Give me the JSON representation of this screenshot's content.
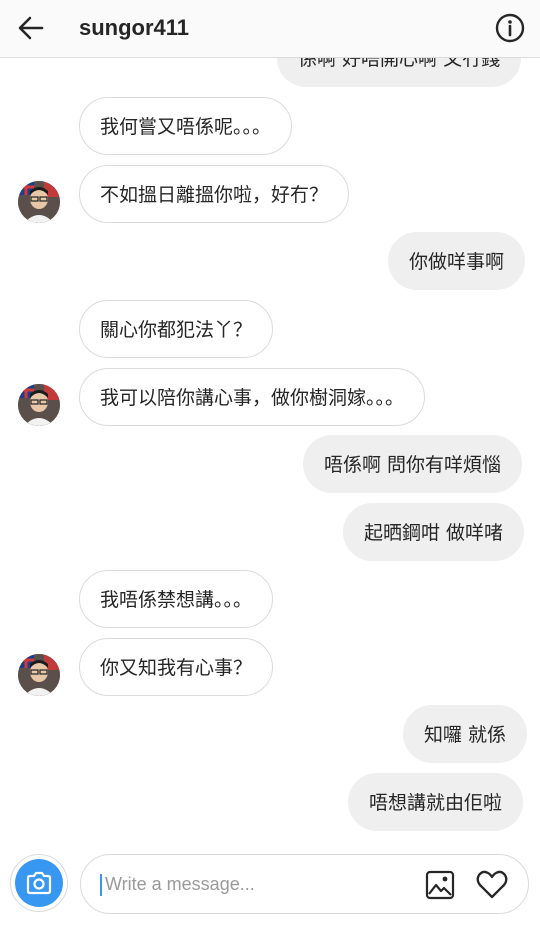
{
  "header": {
    "username": "sungor411",
    "back_icon": "arrow-left-icon",
    "info_icon": "info-icon"
  },
  "messages": [
    {
      "side": "out",
      "text": "係啊 好唔開心啊 又冇錢"
    },
    {
      "side": "in",
      "text": "我何嘗又唔係呢。。。"
    },
    {
      "side": "in",
      "text": "不如搵日離搵你啦，好冇？"
    },
    {
      "side": "out",
      "text": "你做咩事啊"
    },
    {
      "side": "in",
      "text": "關心你都犯法丫？"
    },
    {
      "side": "in",
      "text": "我可以陪你講心事，做你樹洞嫁。。。"
    },
    {
      "side": "out",
      "text": "唔係啊 問你有咩煩惱"
    },
    {
      "side": "out",
      "text": "起晒鋼咁 做咩啫"
    },
    {
      "side": "in",
      "text": "我唔係禁想講。。。"
    },
    {
      "side": "in",
      "text": "你又知我有心事？"
    },
    {
      "side": "out",
      "text": "知囉 就係"
    },
    {
      "side": "out",
      "text": "唔想講就由佢啦"
    }
  ],
  "composer": {
    "placeholder": "Write a message...",
    "camera_icon": "camera-icon",
    "gallery_icon": "image-icon",
    "heart_icon": "heart-icon"
  },
  "colors": {
    "accent": "#3897f0",
    "outgoing_bubble": "#efefef",
    "incoming_border": "#dbdbdb"
  }
}
